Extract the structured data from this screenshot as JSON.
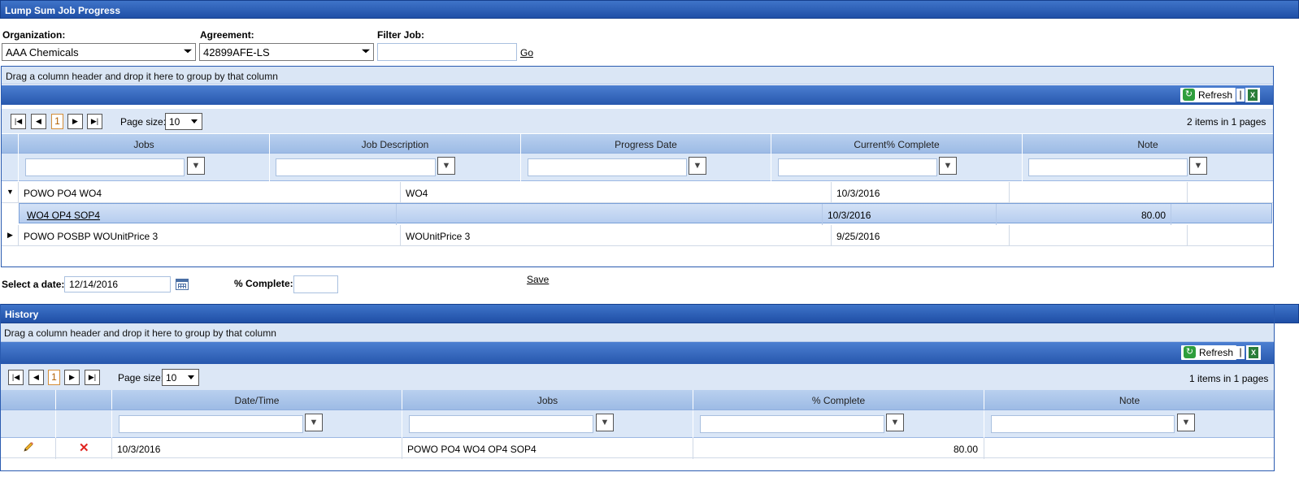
{
  "page_title": "Lump Sum Job Progress",
  "filters": {
    "organization_label": "Organization:",
    "organization_value": "AAA Chemicals",
    "agreement_label": "Agreement:",
    "agreement_value": "42899AFE-LS",
    "filter_job_label": "Filter Job:",
    "filter_job_value": "",
    "go_label": "Go"
  },
  "jobs_grid": {
    "group_hint": "Drag a column header and drop it here to group by that column",
    "refresh_label": "Refresh",
    "separator": "|",
    "pager": {
      "current_page": "1",
      "page_size_label": "Page size:",
      "page_size": "10",
      "info": "2 items in 1 pages"
    },
    "columns": [
      "Jobs",
      "Job Description",
      "Progress Date",
      "Current% Complete",
      "Note"
    ],
    "rows": [
      {
        "expand": "collapse",
        "job": "POWO PO4 WO4",
        "description": "WO4",
        "date": "10/3/2016",
        "complete": "",
        "note": ""
      },
      {
        "child": true,
        "job": "WO4 OP4 SOP4",
        "description": "",
        "date": "10/3/2016",
        "complete": "80.00",
        "note": ""
      },
      {
        "expand": "expand",
        "job": "POWO POSBP WOUnitPrice 3",
        "description": "WOUnitPrice 3",
        "date": "9/25/2016",
        "complete": "",
        "note": ""
      }
    ]
  },
  "entry": {
    "date_label": "Select a date:",
    "date_value": "12/14/2016",
    "complete_label": "% Complete:",
    "complete_value": "",
    "save_label": "Save"
  },
  "history": {
    "title": "History",
    "group_hint": "Drag a column header and drop it here to group by that column",
    "refresh_label": "Refresh",
    "separator": "|",
    "pager": {
      "current_page": "1",
      "page_size_label": "Page size:",
      "page_size": "10",
      "info": "1 items in 1 pages"
    },
    "columns": [
      "",
      "",
      "Date/Time",
      "Jobs",
      "% Complete",
      "Note"
    ],
    "rows": [
      {
        "date": "10/3/2016",
        "job": "POWO PO4 WO4 OP4 SOP4",
        "complete": "80.00",
        "note": ""
      }
    ]
  },
  "icons": {
    "first_page": "first-page-icon",
    "prev_page": "prev-page-icon",
    "next_page": "next-page-icon",
    "last_page": "last-page-icon",
    "filter": "filter-icon",
    "refresh": "refresh-icon",
    "excel": "excel-export-icon",
    "calendar": "calendar-icon",
    "edit": "pencil-icon",
    "delete": "delete-x-icon"
  },
  "colors": {
    "title_bar": "#2a5bb0",
    "header": "#a9c4ea",
    "selected_row": "#c4d7f2",
    "delete_icon": "#e0241f",
    "refresh_icon": "#2e9e3c"
  }
}
